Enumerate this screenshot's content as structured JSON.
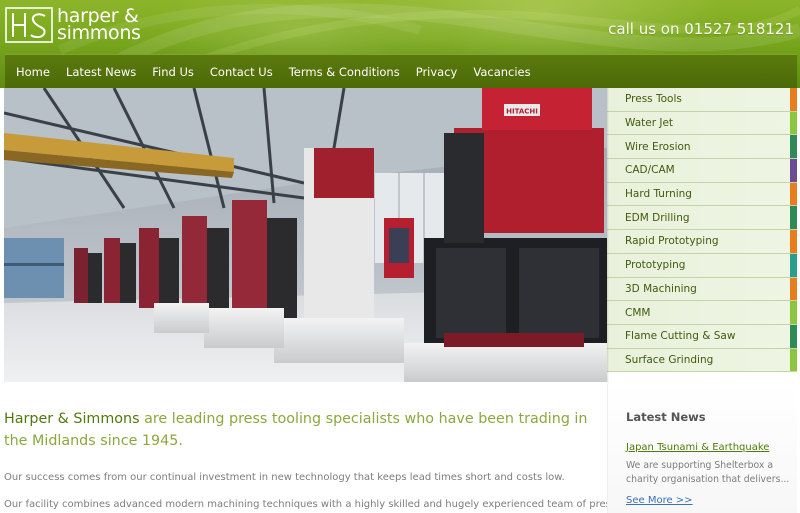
{
  "header": {
    "logo_mark": "HS",
    "logo_line1": "harper &",
    "logo_line2": "simmons",
    "phone": "call us on 01527 518121"
  },
  "nav": {
    "items": [
      "Home",
      "Latest News",
      "Find Us",
      "Contact Us",
      "Terms & Conditions",
      "Privacy",
      "Vacancies"
    ]
  },
  "hero": {
    "machine_brand": "HITACHI"
  },
  "services": {
    "items": [
      {
        "label": "Press Tools",
        "tab_color": "#e87d1e"
      },
      {
        "label": "Water Jet",
        "tab_color": "#8cc63f"
      },
      {
        "label": "Wire Erosion",
        "tab_color": "#2e8b57"
      },
      {
        "label": "CAD/CAM",
        "tab_color": "#6a4c93"
      },
      {
        "label": "Hard Turning",
        "tab_color": "#e87d1e"
      },
      {
        "label": "EDM Drilling",
        "tab_color": "#2e8b57"
      },
      {
        "label": "Rapid Prototyping",
        "tab_color": "#e87d1e"
      },
      {
        "label": "Prototyping",
        "tab_color": "#2a9d8f"
      },
      {
        "label": "3D Machining",
        "tab_color": "#e87d1e"
      },
      {
        "label": "CMM",
        "tab_color": "#8cc63f"
      },
      {
        "label": "Flame Cutting & Saw",
        "tab_color": "#2e8b57"
      },
      {
        "label": "Surface Grinding",
        "tab_color": "#8cc63f"
      }
    ]
  },
  "main": {
    "intro_brand": "Harper & Simmons",
    "intro_rest": " are leading press tooling specialists who have been trading in the Midlands since 1945.",
    "para1": "Our success comes from our continual investment in new technology that keeps lead times short and costs low.",
    "para2": "Our facility combines advanced modern machining techniques with a highly skilled and hugely experienced team of press"
  },
  "news": {
    "heading": "Latest News",
    "title": "Japan Tsunami & Earthquake",
    "body": "We are supporting Shelterbox a charity organisation that delivers...",
    "more": "See More >>"
  },
  "colors": {
    "brand_green": "#6f9b1b",
    "nav_green": "#4c6a07",
    "link_blue": "#3b6fb6"
  }
}
